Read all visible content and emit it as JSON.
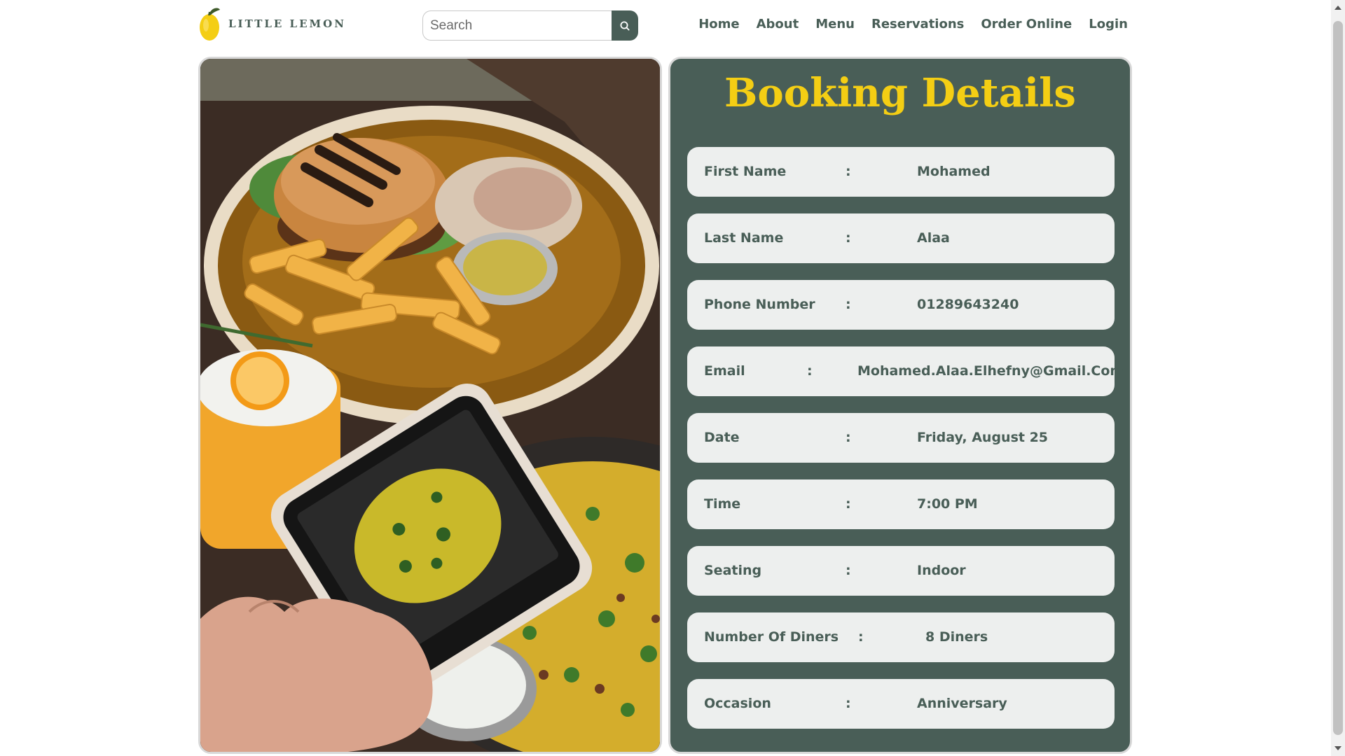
{
  "brand": {
    "name": "LITTLE LEMON"
  },
  "search": {
    "placeholder": "Search"
  },
  "nav": {
    "home": "Home",
    "about": "About",
    "menu": "Menu",
    "reservations": "Reservations",
    "order_online": "Order Online",
    "login": "Login"
  },
  "booking": {
    "title": "Booking Details",
    "separator": ":",
    "rows": [
      {
        "label": "First Name",
        "value": "Mohamed"
      },
      {
        "label": "Last Name",
        "value": "Alaa"
      },
      {
        "label": "Phone Number",
        "value": "01289643240"
      },
      {
        "label": "Email",
        "value": "Mohamed.Alaa.Elhefny@Gmail.Com"
      },
      {
        "label": "Date",
        "value": "Friday, August 25"
      },
      {
        "label": "Time",
        "value": "7:00 PM"
      },
      {
        "label": "Seating",
        "value": "Indoor"
      },
      {
        "label": "Number Of Diners",
        "value": "8 Diners"
      },
      {
        "label": "Occasion",
        "value": "Anniversary"
      }
    ]
  },
  "colors": {
    "primary_green": "#495e57",
    "accent_yellow": "#f4ce14",
    "row_bg": "#edefee"
  },
  "icons": {
    "logo": "lemon-icon",
    "search": "search-icon"
  }
}
